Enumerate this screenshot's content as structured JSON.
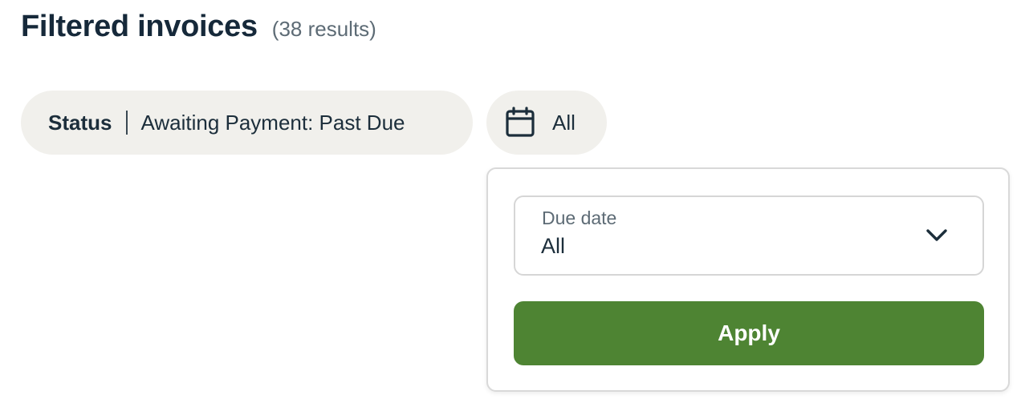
{
  "header": {
    "title": "Filtered invoices",
    "result_count": "(38 results)"
  },
  "filters": {
    "status": {
      "label": "Status",
      "value": "Awaiting Payment: Past Due"
    },
    "date": {
      "icon": "calendar-icon",
      "value": "All"
    }
  },
  "dropdown": {
    "due_date": {
      "label": "Due date",
      "value": "All",
      "icon": "chevron-down-icon"
    },
    "apply_label": "Apply"
  },
  "colors": {
    "chip_background": "#f1f0ec",
    "primary_text": "#16293a",
    "muted_text": "#5d6b75",
    "apply_button": "#4e8433"
  }
}
